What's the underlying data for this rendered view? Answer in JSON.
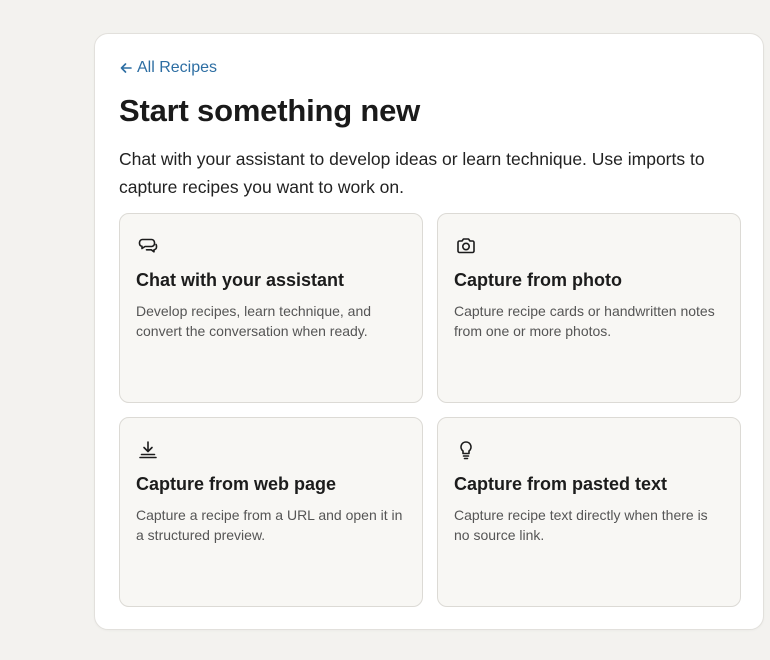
{
  "nav": {
    "back_label": "All Recipes"
  },
  "page": {
    "title": "Start something new",
    "intro": "Chat with your assistant to develop ideas or learn technique. Use imports to capture recipes you want to work on."
  },
  "options": [
    {
      "icon": "chat-bubbles-icon",
      "title": "Chat with your assistant",
      "description": "Develop recipes, learn technique, and convert the conversation when ready."
    },
    {
      "icon": "camera-icon",
      "title": "Capture from photo",
      "description": "Capture recipe cards or handwritten notes from one or more photos."
    },
    {
      "icon": "download-icon",
      "title": "Capture from web page",
      "description": "Capture a recipe from a URL and open it in a structured preview."
    },
    {
      "icon": "lightbulb-icon",
      "title": "Capture from pasted text",
      "description": "Capture recipe text directly when there is no source link."
    }
  ],
  "colors": {
    "link": "#2d6ea3",
    "card_bg": "#f8f7f4",
    "page_bg": "#f3f2ef"
  }
}
